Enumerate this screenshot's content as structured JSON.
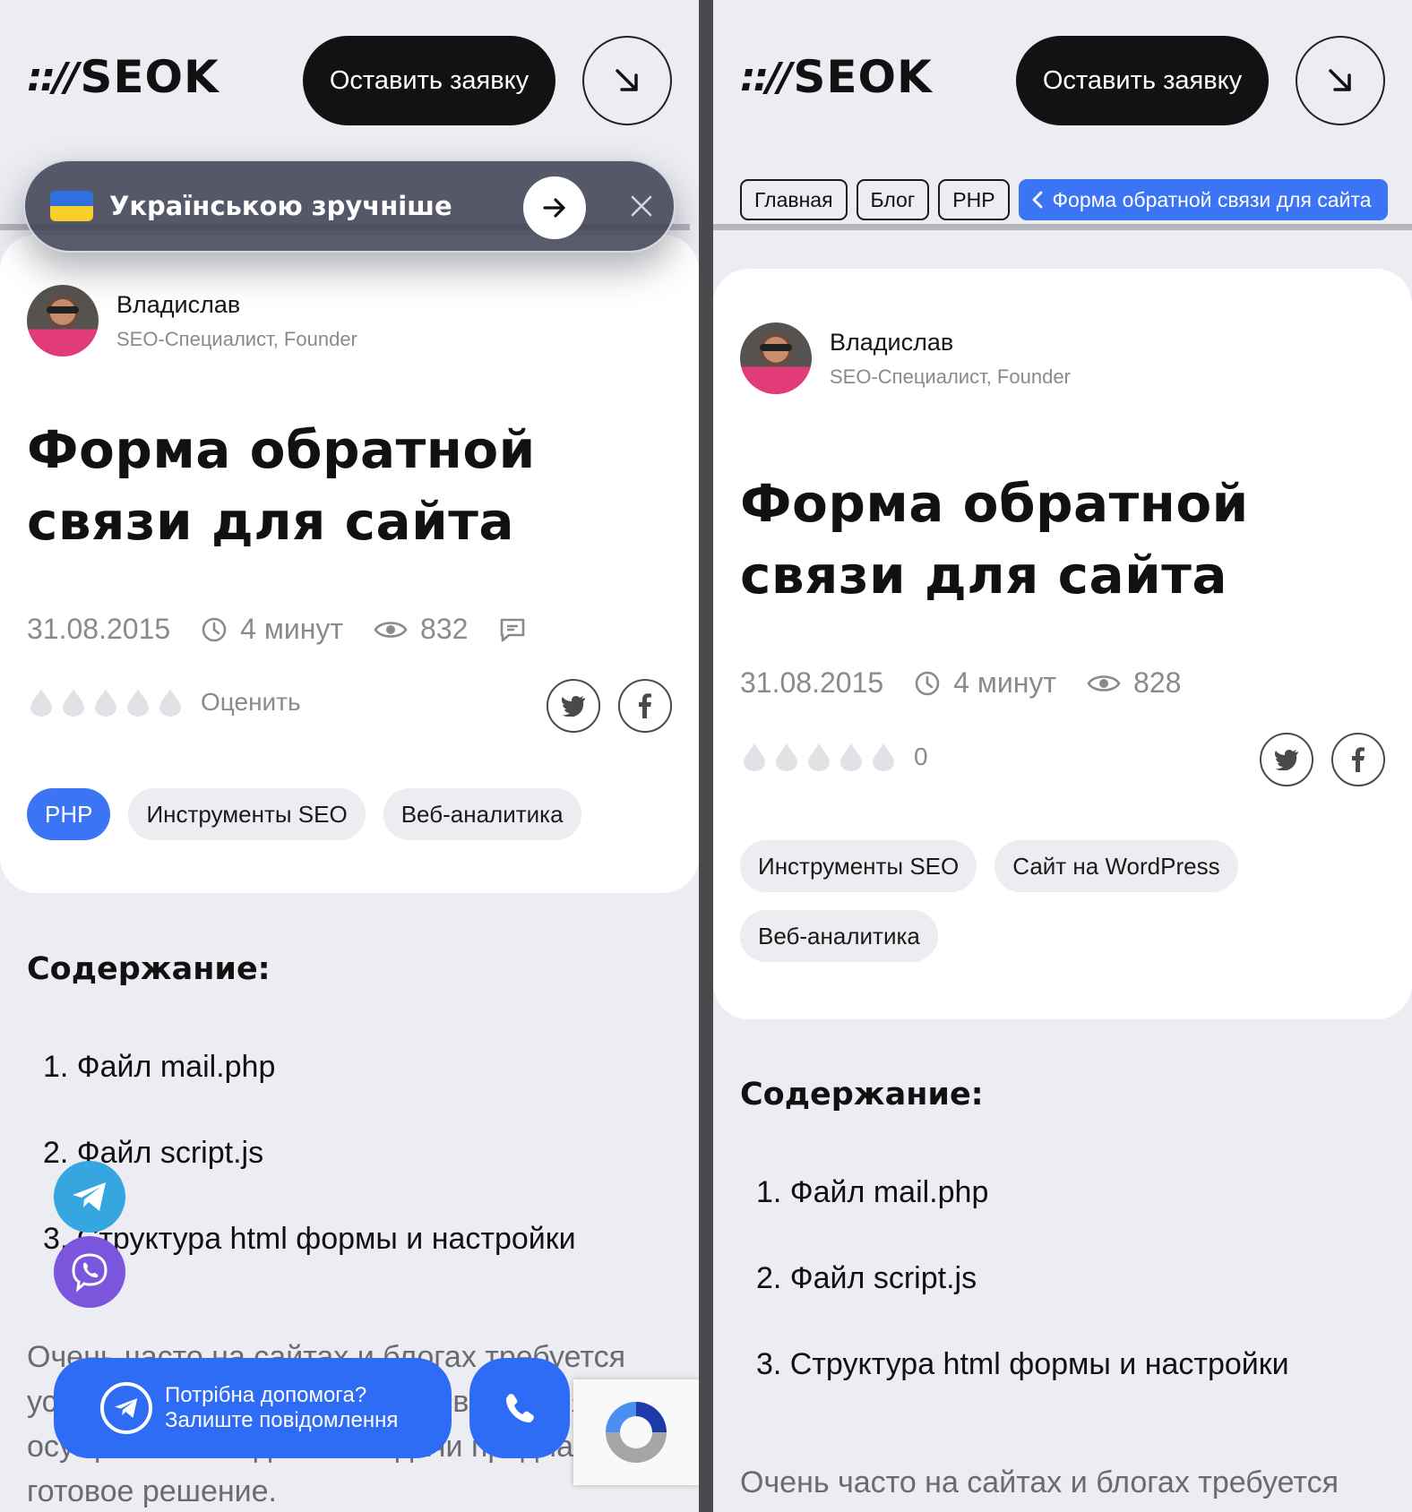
{
  "header": {
    "logo_mark": ":://",
    "logo_word": "SEOK",
    "order_button": "Оставить заявку",
    "arrow_button_icon": "arrow-down-right-icon"
  },
  "breadcrumbs": [
    "Главная",
    "Блог",
    "PHP"
  ],
  "breadcrumb_current": "Форма обратной связи для сайта",
  "lang_banner": {
    "text": "Українською зручніше",
    "flag": "ukraine-flag-icon"
  },
  "author": {
    "name": "Владислав",
    "role": "SEO-Специалист, Founder"
  },
  "article": {
    "title_line1": "Форма обратной",
    "title_line2": "связи для сайта",
    "date": "31.08.2015",
    "read_time": "4 минут",
    "views_left": "832",
    "views_right": "828",
    "rate_label": "Оценить",
    "rating_value": "0"
  },
  "tags_left": [
    "PHP",
    "Инструменты SEO",
    "Веб-аналитика"
  ],
  "tags_right": [
    "Инструменты SEO",
    "Сайт на WordPress",
    "Веб-аналитика"
  ],
  "toc": {
    "title": "Содержание:",
    "items": [
      "1.  Файл mail.php",
      "2. Файл script.js",
      "3. Структура html формы и настройки"
    ]
  },
  "body_text_left": "Очень часто на сайтах и блогах требуется установить форму обратной связи. Для осуществления данной задачи предлагаю готовое решение.",
  "body_text_right": "Очень часто на сайтах и блогах требуется",
  "help_widget": {
    "line1": "Потрібна допомога?",
    "line2": "Залиште повідомлення"
  },
  "colors": {
    "accent": "#3b74f5",
    "telegram": "#35a6e0",
    "viber": "#7b56dc",
    "background": "#ececf3"
  }
}
